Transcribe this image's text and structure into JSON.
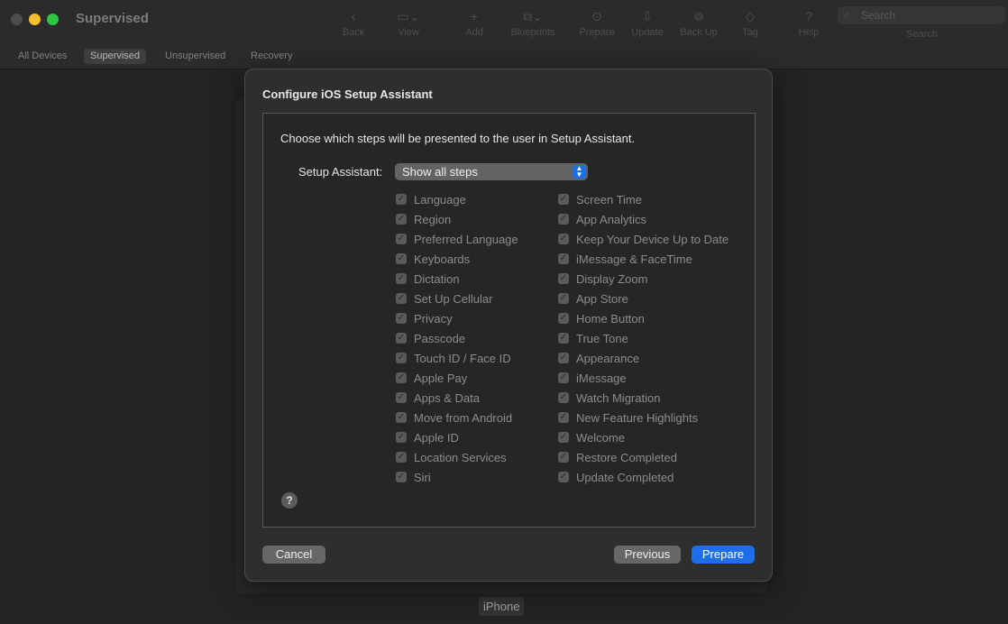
{
  "window": {
    "title": "Supervised",
    "toolbar": [
      {
        "label": "Back",
        "icon": "chevron-left-icon",
        "glyph": "‹"
      },
      {
        "label": "View",
        "icon": "view-icon",
        "glyph": "▭⌄"
      },
      {
        "label": "Add",
        "icon": "plus-icon",
        "glyph": "+"
      },
      {
        "label": "Blueprints",
        "icon": "blueprints-icon",
        "glyph": "⧉⌄"
      },
      {
        "label": "Prepare",
        "icon": "prepare-icon",
        "glyph": "⊙"
      },
      {
        "label": "Update",
        "icon": "update-icon",
        "glyph": "⇩"
      },
      {
        "label": "Back Up",
        "icon": "backup-icon",
        "glyph": "⊚"
      },
      {
        "label": "Tag",
        "icon": "tag-icon",
        "glyph": "◇"
      },
      {
        "label": "Help",
        "icon": "help-icon",
        "glyph": "?"
      }
    ],
    "search": {
      "placeholder": "Search",
      "label": "Search"
    }
  },
  "tabs": [
    {
      "label": "All Devices",
      "active": false
    },
    {
      "label": "Supervised",
      "active": true
    },
    {
      "label": "Unsupervised",
      "active": false
    },
    {
      "label": "Recovery",
      "active": false
    }
  ],
  "device_label": "iPhone",
  "sheet": {
    "title": "Configure iOS Setup Assistant",
    "instructions": "Choose which steps will be presented to the user in Setup Assistant.",
    "setup_assistant_label": "Setup Assistant:",
    "setup_assistant_value": "Show all steps",
    "left_steps": [
      "Language",
      "Region",
      "Preferred Language",
      "Keyboards",
      "Dictation",
      "Set Up Cellular",
      "Privacy",
      "Passcode",
      "Touch ID / Face ID",
      "Apple Pay",
      "Apps & Data",
      "Move from Android",
      "Apple ID",
      "Location Services",
      "Siri"
    ],
    "right_steps": [
      "Screen Time",
      "App Analytics",
      "Keep Your Device Up to Date",
      "iMessage & FaceTime",
      "Display Zoom",
      "App Store",
      "Home Button",
      "True Tone",
      "Appearance",
      "iMessage",
      "Watch Migration",
      "New Feature Highlights",
      "Welcome",
      "Restore Completed",
      "Update Completed"
    ],
    "buttons": {
      "cancel": "Cancel",
      "previous": "Previous",
      "prepare": "Prepare"
    },
    "help_glyph": "?"
  },
  "colors": {
    "accent": "#1e6ee8",
    "yellow": "#f4bf2e",
    "green": "#2cc63f"
  }
}
